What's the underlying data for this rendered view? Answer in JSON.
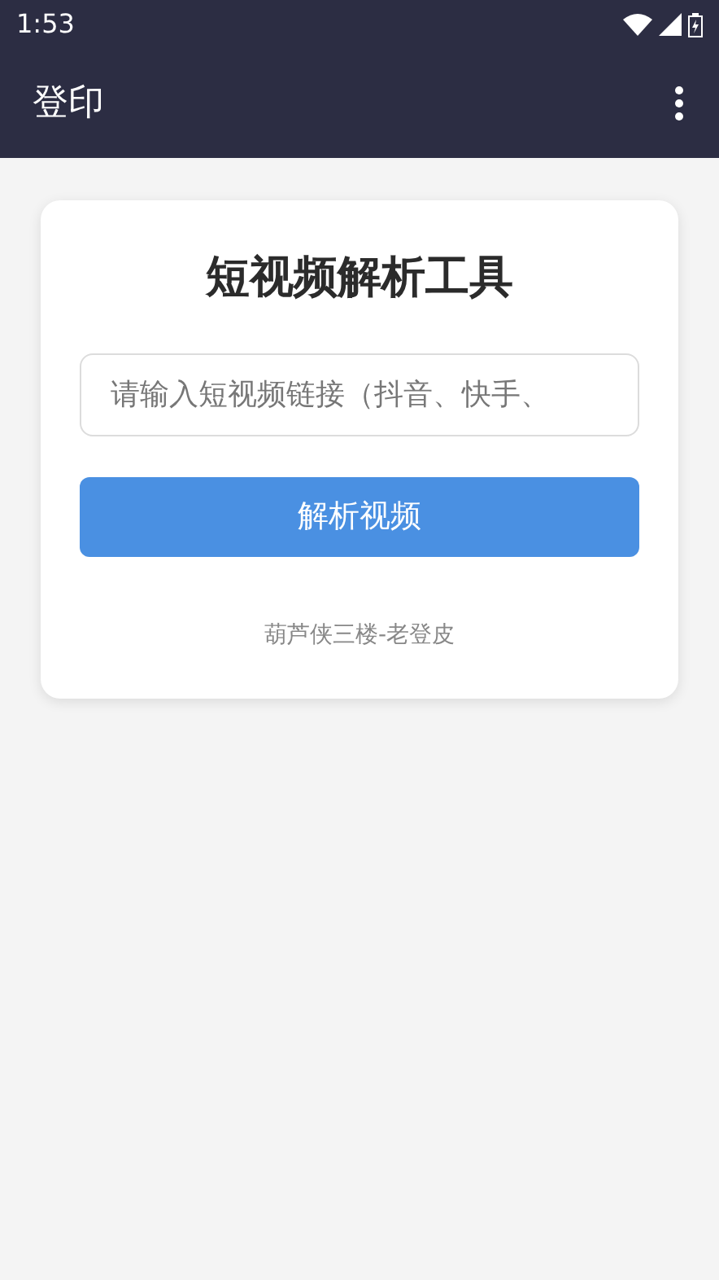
{
  "status_bar": {
    "time": "1:53"
  },
  "app_bar": {
    "title": "登印"
  },
  "card": {
    "title": "短视频解析工具",
    "link_field": {
      "placeholder": "请输入短视频链接（抖音、快手、"
    },
    "parse_button": "解析视频",
    "footer": "葫芦侠三楼-老登皮"
  }
}
